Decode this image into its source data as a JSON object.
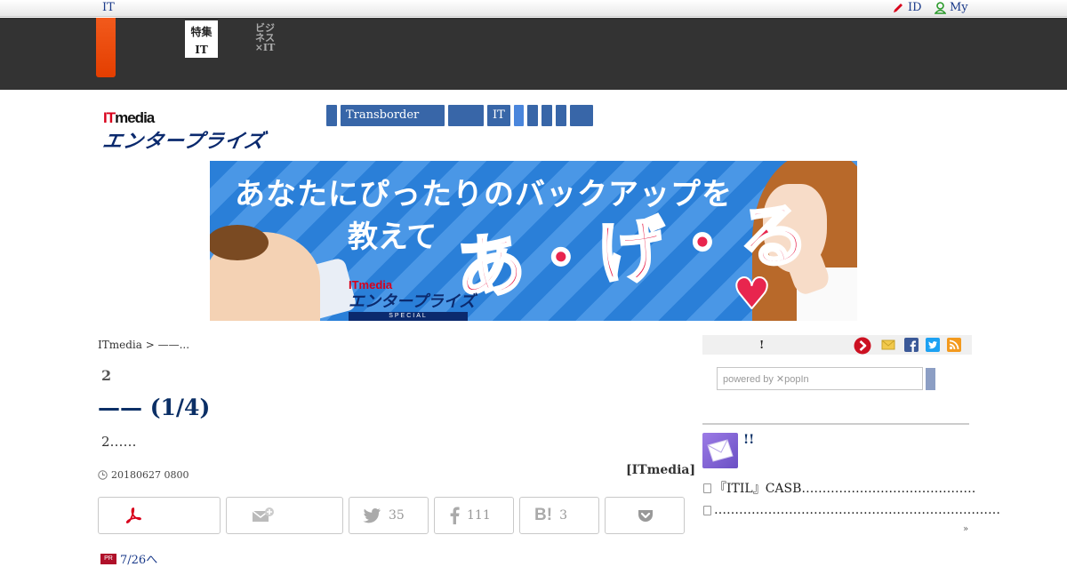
{
  "topbar": {
    "left_label": "IT",
    "id_label": "ID",
    "my_label": "My"
  },
  "header": {
    "tab_active_line1": "特集",
    "tab_active_line2": "IT",
    "tab_other_line1": "ビジネス",
    "tab_other_line2": "×IT"
  },
  "logo": {
    "line1_red": "IT",
    "line1_black": "media",
    "line2": "エンタープライズ"
  },
  "nav": {
    "items": [
      "",
      "Transborder",
      "",
      "IT",
      "",
      "",
      "",
      "",
      ""
    ]
  },
  "banner": {
    "line1": "あなたにぴったりのバックアップを",
    "line2": "教えて",
    "line3": "あ・げ・る",
    "logo_a": "ITmedia",
    "logo_b": "エンタープライズ",
    "logo_c": "SPECIAL"
  },
  "breadcrumb": "ITmedia  > ——...",
  "article": {
    "kicker": "2",
    "title": "—— (1/4)",
    "lead": "2……",
    "date": "20180627 0800",
    "source": "[ITmedia]"
  },
  "share": {
    "twitter_count": "35",
    "facebook_count": "111",
    "hatena_count": "3"
  },
  "pr": {
    "label": "PR",
    "text": "7/26へ"
  },
  "sidebar": {
    "strip_text": "!",
    "search_placeholder": "powered by ✕popIn",
    "mail_heading": "!!",
    "items": [
      "『ITIL』CASB……………………………………",
      "……………………………………………………………"
    ],
    "more": "»"
  },
  "colors": {
    "accent_orange": "#e8470e",
    "nav_blue": "#3866a8",
    "title_navy": "#0b2f66",
    "dark_header": "#333333"
  }
}
